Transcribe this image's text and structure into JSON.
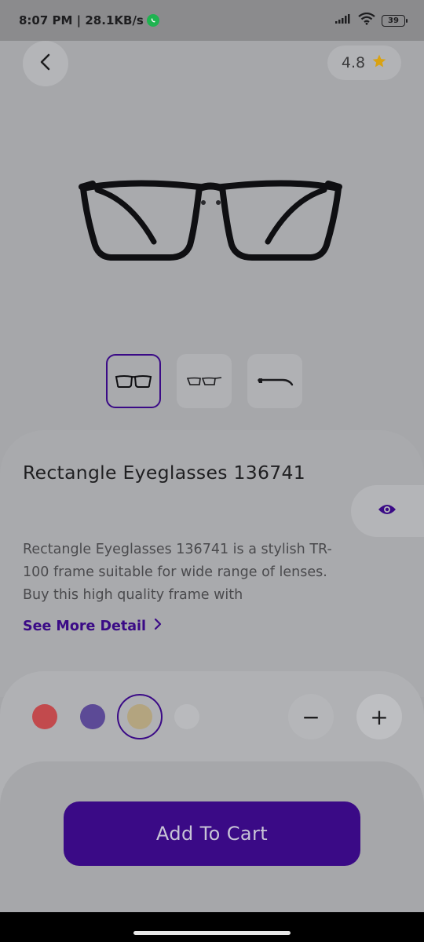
{
  "status_bar": {
    "time_speed": "8:07 PM | 28.1KB/s",
    "battery_level": "39",
    "icons": [
      "whatsapp-icon",
      "signal-icon",
      "wifi-icon",
      "battery-icon"
    ]
  },
  "header": {
    "back_icon": "chevron-left-icon",
    "rating": "4.8",
    "rating_icon": "star-icon"
  },
  "product": {
    "title": "Rectangle Eyeglasses 136741",
    "description": "Rectangle Eyeglasses 136741 is a stylish TR-100 frame suitable for wide range of lenses. Buy this high quality frame with",
    "see_more_label": "See More Detail",
    "thumbnails": [
      "front-view",
      "angled-view",
      "side-view"
    ],
    "try_on_icon": "eye-icon"
  },
  "colors": {
    "swatches": [
      "#c24a4d",
      "#5c4a96",
      "#b3a47f",
      "#b9babd"
    ],
    "selected_index": 2,
    "accent": "#3a0a86"
  },
  "quantity": {
    "minus_label": "−",
    "plus_label": "+"
  },
  "cart": {
    "button_label": "Add To Cart"
  }
}
